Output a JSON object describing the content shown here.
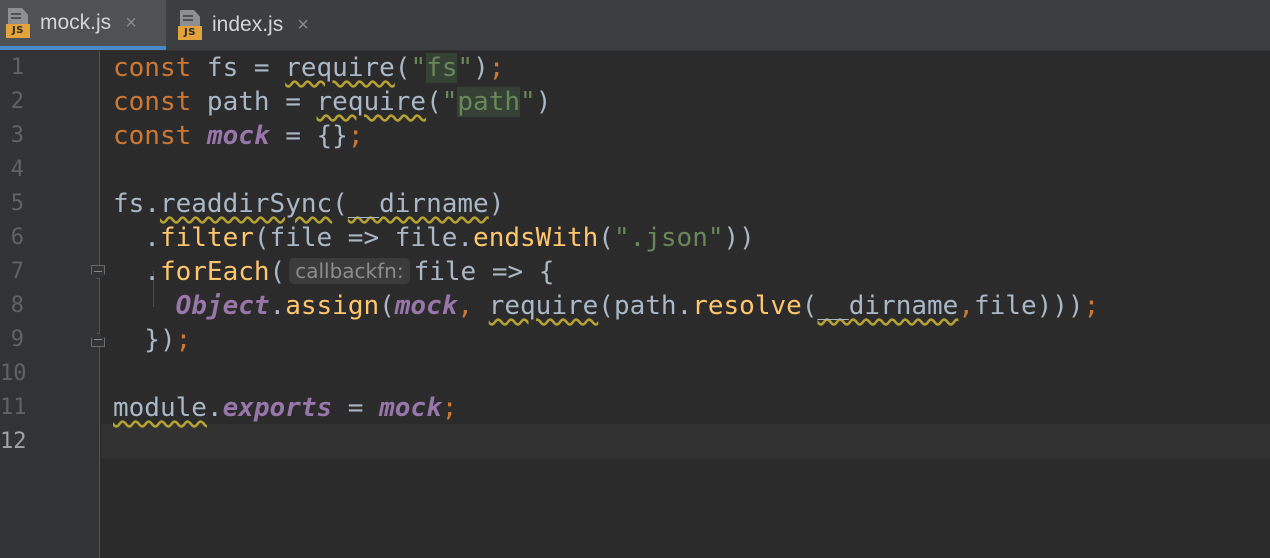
{
  "tabs": [
    {
      "name": "mock.js",
      "icon": "javascript-file-icon",
      "icon_badge": "JS",
      "close": "×",
      "active": true
    },
    {
      "name": "index.js",
      "icon": "javascript-file-icon",
      "icon_badge": "JS",
      "close": "×",
      "active": false
    }
  ],
  "gutter": {
    "line_numbers": [
      "1",
      "2",
      "3",
      "4",
      "5",
      "6",
      "7",
      "8",
      "9",
      "10",
      "11",
      "12"
    ],
    "current_line": "12"
  },
  "code": {
    "l1": {
      "kw1": "const",
      "p1": " fs = ",
      "call": "require",
      "p2": "(",
      "q1": "\"",
      "s": "fs",
      "q2": "\"",
      "p3": ")",
      "semi": ";"
    },
    "l2": {
      "kw1": "const",
      "p1": " path = ",
      "call": "require",
      "p2": "(",
      "q1": "\"",
      "s": "path",
      "q2": "\"",
      "p3": ")"
    },
    "l3": {
      "kw1": "const",
      "p1": " ",
      "v": "mock",
      "p2": " = {}",
      "semi": ";"
    },
    "l5": {
      "obj": "fs",
      "p1": ".",
      "call": "readdirSync",
      "p2": "(",
      "arg": "__dirname",
      "p3": ")"
    },
    "l6": {
      "p1": "  .",
      "call": "filter",
      "p2": "(file => file.",
      "m": "endsWith",
      "p3": "(",
      "s": "\".json\"",
      "p4": "))"
    },
    "l7": {
      "p1": "  .",
      "call": "forEach",
      "p2": "(",
      "hint": "callbackfn:",
      "p3": "file => {"
    },
    "l8": {
      "p1": "    ",
      "cls": "Object",
      "p2": ".",
      "m": "assign",
      "p3": "(",
      "v": "mock",
      "c1": ",",
      "p4": " ",
      "req": "require",
      "p5": "(path.",
      "m2": "resolve",
      "p6": "(",
      "arg": "__dirname",
      "c2": ",",
      "p7": "file)))",
      "semi": ";"
    },
    "l9": {
      "p1": "  })",
      "semi": ";"
    },
    "l11": {
      "obj": "module",
      "p1": ".",
      "prop": "exports",
      "p2": " = ",
      "v": "mock",
      "semi": ";"
    }
  },
  "colors": {
    "background": "#2b2b2b",
    "keyword": "#cc7832",
    "string": "#6a8759",
    "function": "#ffc66d",
    "global": "#9876aa",
    "plain": "#a9b7c6",
    "tab_accent": "#4a88c7",
    "js_badge": "#e2a33c"
  }
}
